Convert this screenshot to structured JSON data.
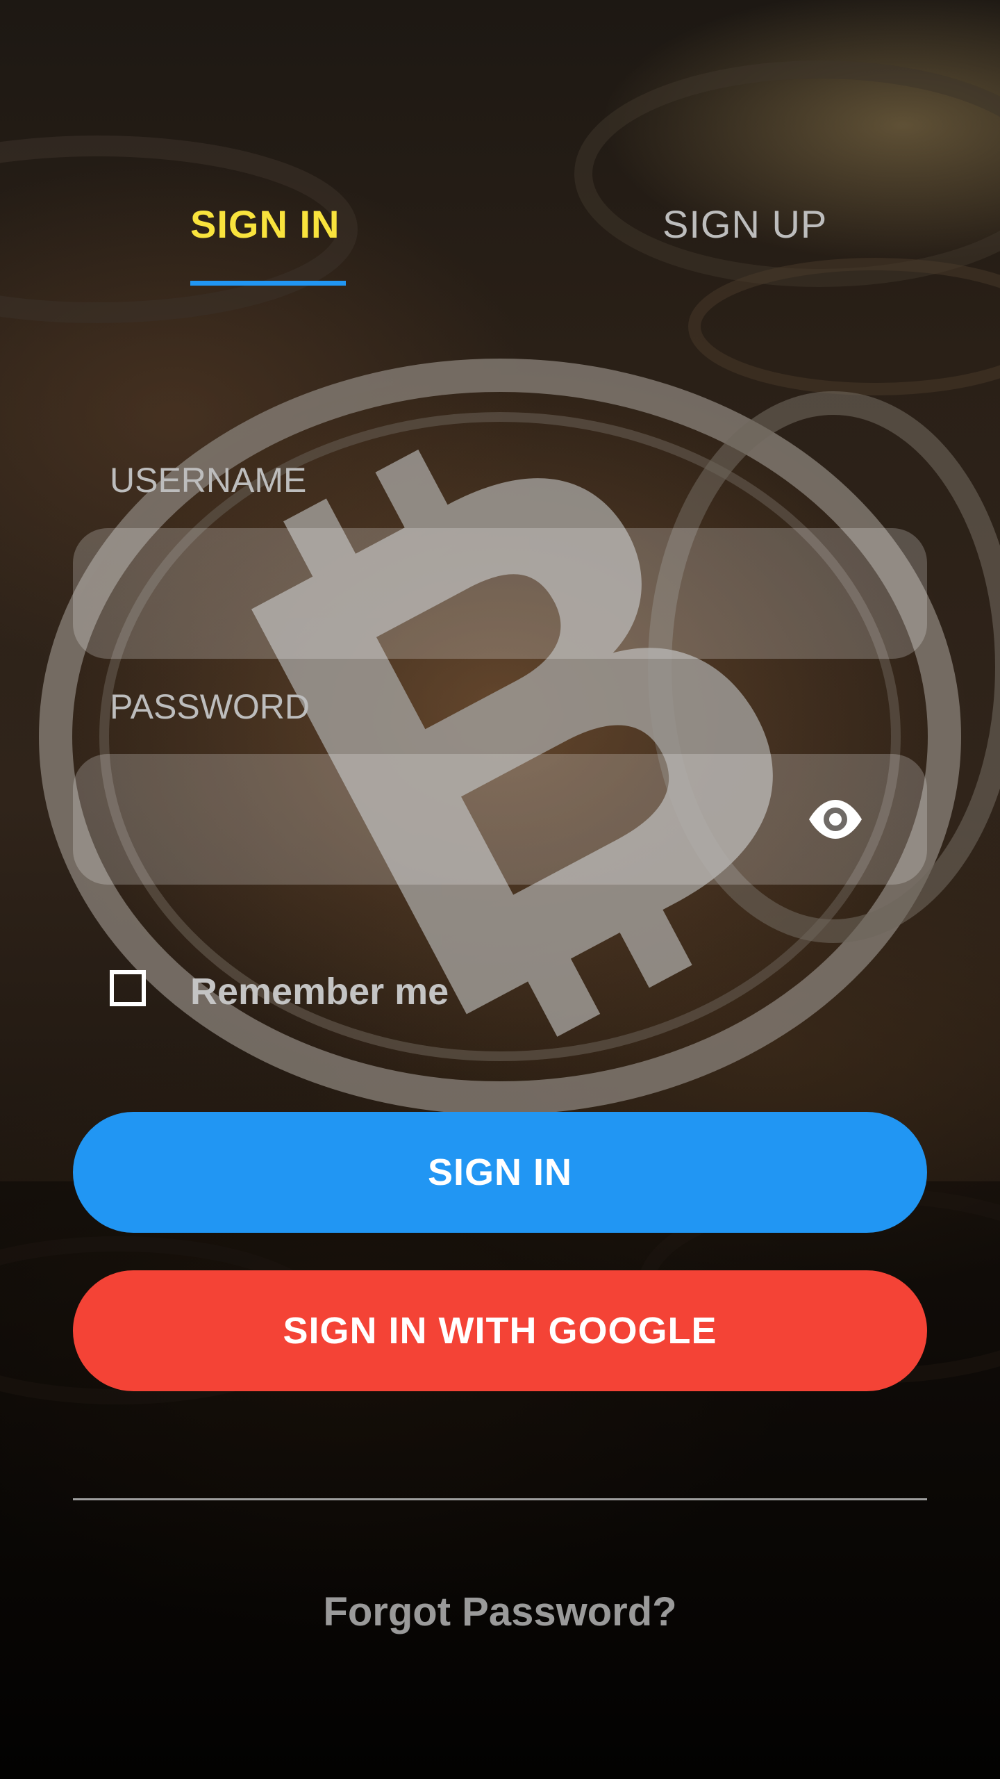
{
  "tabs": {
    "sign_in": "SIGN IN",
    "sign_up": "SIGN UP",
    "active": "sign_in"
  },
  "form": {
    "username_label": "USERNAME",
    "username_value": "",
    "password_label": "PASSWORD",
    "password_value": "",
    "password_toggle_icon": "eye-icon",
    "remember_me_label": "Remember me",
    "remember_me_checked": false
  },
  "buttons": {
    "sign_in": "SIGN IN",
    "sign_in_google": "SIGN IN WITH GOOGLE"
  },
  "links": {
    "forgot_password": "Forgot Password?"
  },
  "background": {
    "icon": "bitcoin-coin-icon"
  },
  "colors": {
    "active_tab": "#f9e33d",
    "tab_indicator": "#2196f3",
    "sign_in_button": "#2196f3",
    "google_button": "#f44336"
  }
}
